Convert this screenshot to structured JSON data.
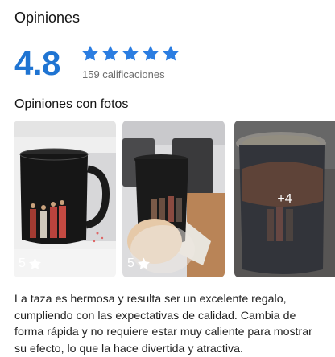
{
  "header": {
    "title": "Opiniones"
  },
  "summary": {
    "rating": "4.8",
    "stars": 5,
    "count_label": "159 calificaciones",
    "star_color": "#2b7de1"
  },
  "photos_section": {
    "title": "Opiniones con fotos",
    "photos": [
      {
        "rating": "5",
        "icon": "star-icon"
      },
      {
        "rating": "5",
        "icon": "star-icon"
      },
      {
        "more_label": "+4"
      }
    ]
  },
  "review": {
    "text": "La taza es hermosa y resulta ser un excelente regalo, cumpliendo con las expectativas de calidad. Cambia de forma rápida y no requiere estar muy caliente para mostrar su efecto, lo que la hace divertida y atractiva."
  }
}
